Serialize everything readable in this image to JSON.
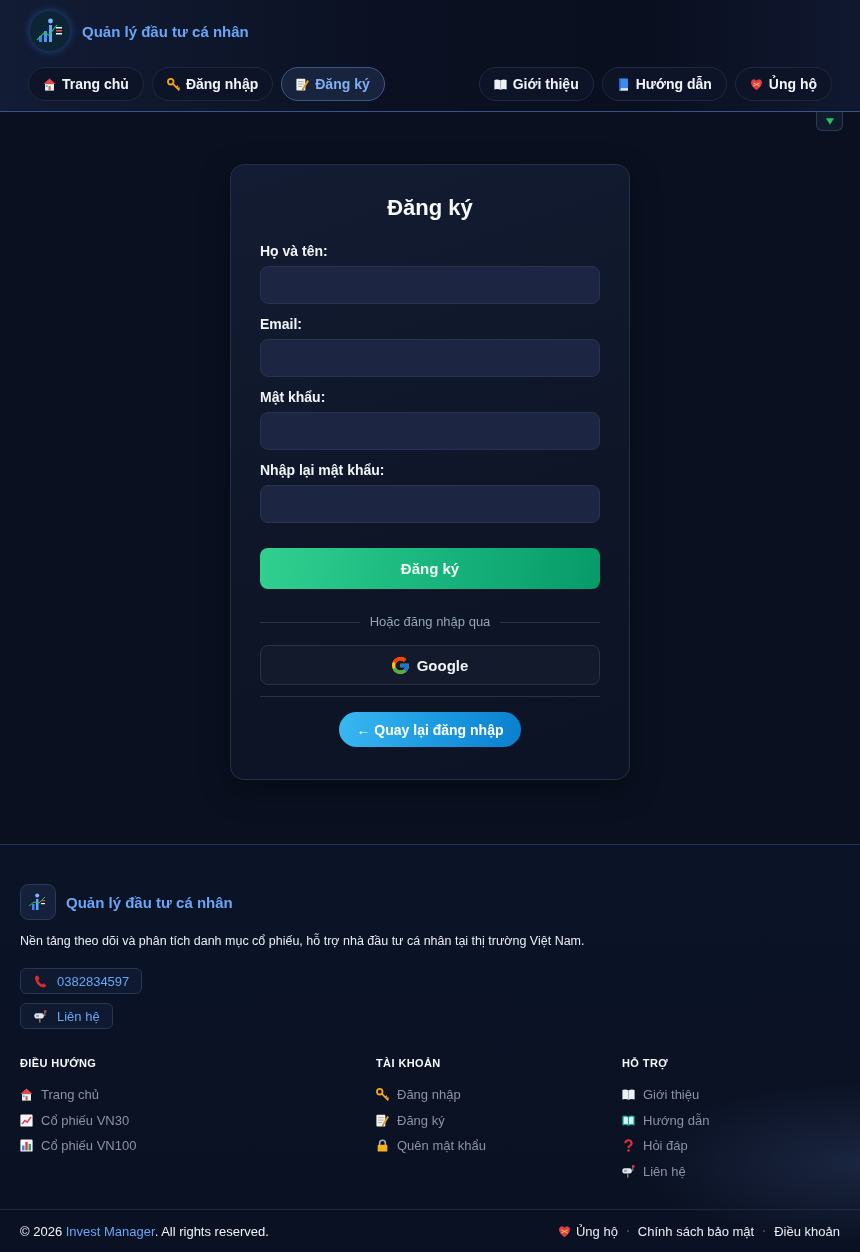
{
  "header": {
    "brand": "Quản lý đầu tư cá nhân",
    "nav_left": [
      {
        "label": "Trang chủ",
        "selected": false
      },
      {
        "label": "Đăng nhập",
        "selected": false
      },
      {
        "label": "Đăng ký",
        "selected": true
      }
    ],
    "nav_right": [
      {
        "label": "Giới thiệu",
        "selected": false
      },
      {
        "label": "Hướng dẫn",
        "selected": false
      },
      {
        "label": "Ủng hộ",
        "selected": false
      }
    ]
  },
  "form": {
    "title": "Đăng ký",
    "fields": [
      {
        "label": "Họ và tên:"
      },
      {
        "label": "Email:"
      },
      {
        "label": "Mật khẩu:"
      },
      {
        "label": "Nhập lại mật khẩu:"
      }
    ],
    "submit": "Đăng ký",
    "divider_text": "Hoặc đăng nhập qua",
    "google_button": "Google",
    "back_button": "← Quay lại đăng nhập"
  },
  "footer": {
    "brand": "Quản lý đầu tư cá nhân",
    "description": "Nền tảng theo dõi và phân tích danh mục cổ phiếu, hỗ trợ nhà đầu tư cá nhân tại thị trường Việt Nam.",
    "contacts": [
      "0382834597",
      "Liên hệ"
    ],
    "columns": [
      {
        "heading": "ĐIỀU HƯỚNG",
        "links": [
          "Trang chủ",
          "Cổ phiếu VN30",
          "Cổ phiếu VN100"
        ]
      },
      {
        "heading": "TÀI KHOẢN",
        "links": [
          "Đăng nhập",
          "Đăng ký",
          "Quên mật khẩu"
        ]
      },
      {
        "heading": "HỖ TRỢ",
        "links": [
          "Giới thiệu",
          "Hướng dẫn",
          "Hỏi đáp",
          "Liên hệ"
        ]
      }
    ],
    "copyright": {
      "before": "© 2026 ",
      "link": "Invest Manager",
      "after": ". All rights reserved."
    },
    "bottom_links": [
      "Ủng hộ",
      "Chính sách bảo mật",
      "Điều khoản"
    ]
  }
}
